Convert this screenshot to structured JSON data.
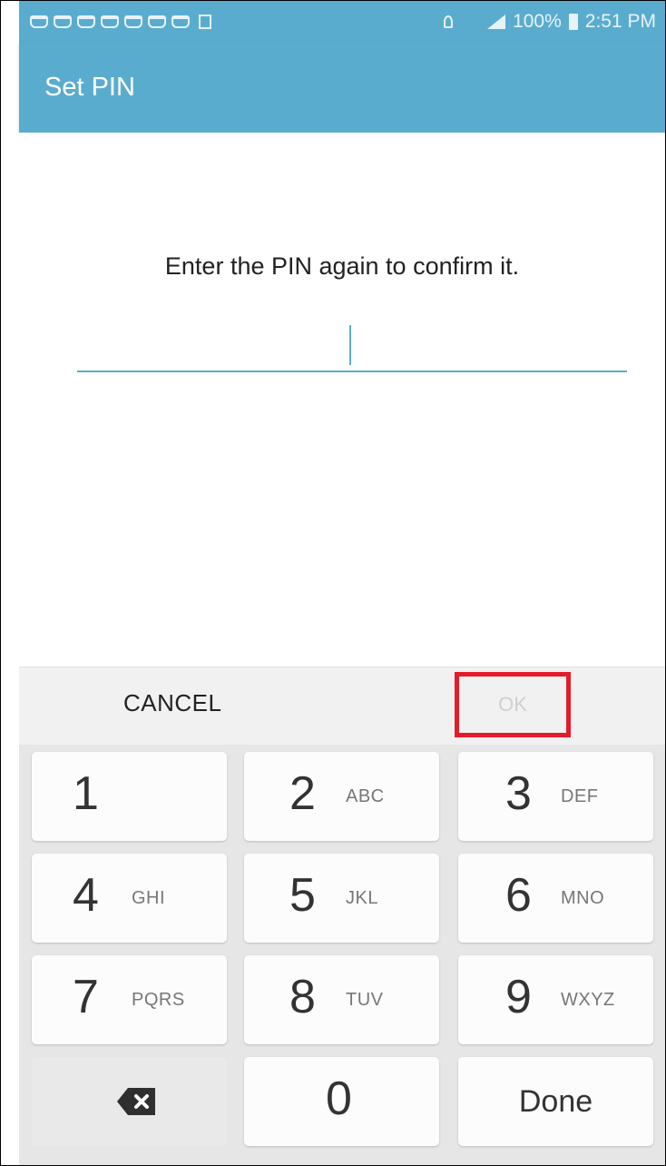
{
  "status_bar": {
    "battery_percent": "100%",
    "time": "2:51 PM",
    "notification_icons": [
      "app-notification-icon",
      "app-notification-icon",
      "app-notification-icon",
      "app-notification-icon",
      "app-notification-icon",
      "app-notification-icon",
      "app-notification-icon",
      "gallery-icon"
    ]
  },
  "app_bar": {
    "title": "Set PIN"
  },
  "content": {
    "prompt": "Enter the PIN again to confirm it.",
    "pin_value": ""
  },
  "actions": {
    "cancel_label": "CANCEL",
    "ok_label": "OK"
  },
  "keypad": {
    "keys": [
      {
        "digit": "1",
        "letters": ""
      },
      {
        "digit": "2",
        "letters": "ABC"
      },
      {
        "digit": "3",
        "letters": "DEF"
      },
      {
        "digit": "4",
        "letters": "GHI"
      },
      {
        "digit": "5",
        "letters": "JKL"
      },
      {
        "digit": "6",
        "letters": "MNO"
      },
      {
        "digit": "7",
        "letters": "PQRS"
      },
      {
        "digit": "8",
        "letters": "TUV"
      },
      {
        "digit": "9",
        "letters": "WXYZ"
      },
      {
        "digit": "0",
        "letters": ""
      }
    ],
    "done_label": "Done"
  },
  "colors": {
    "accent": "#5aaccf",
    "highlight": "#e31b2a",
    "keypad_bg": "#e6e6e6"
  }
}
